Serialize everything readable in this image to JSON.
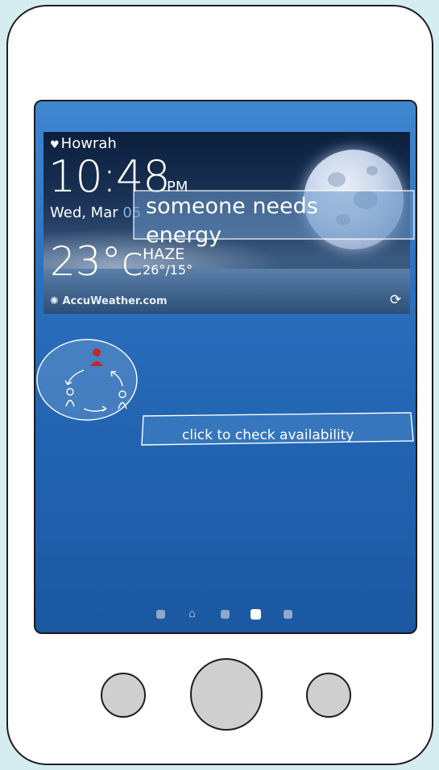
{
  "weather": {
    "city": "Howrah",
    "time": "10:48",
    "ampm": "PM",
    "date_prefix": "Wed, Mar ",
    "date_day": "05",
    "temperature": "23°c",
    "condition": "HAZE",
    "hi_lo": "26°/15°",
    "source": "AccuWeather.com"
  },
  "notification": {
    "title_line1": "someone needs",
    "title_line2": "energy",
    "subtitle": "click to check availability"
  },
  "home_screen": {
    "page_count": 5,
    "active_page": 4
  },
  "icons": [
    "location-pin-icon",
    "refresh-icon",
    "accuweather-logo-icon",
    "energy-sharing-icon",
    "home-icon"
  ],
  "colors": {
    "background": "#d5edf1",
    "screen_blue": "#2b6fbe",
    "user_red": "#c0282f"
  }
}
